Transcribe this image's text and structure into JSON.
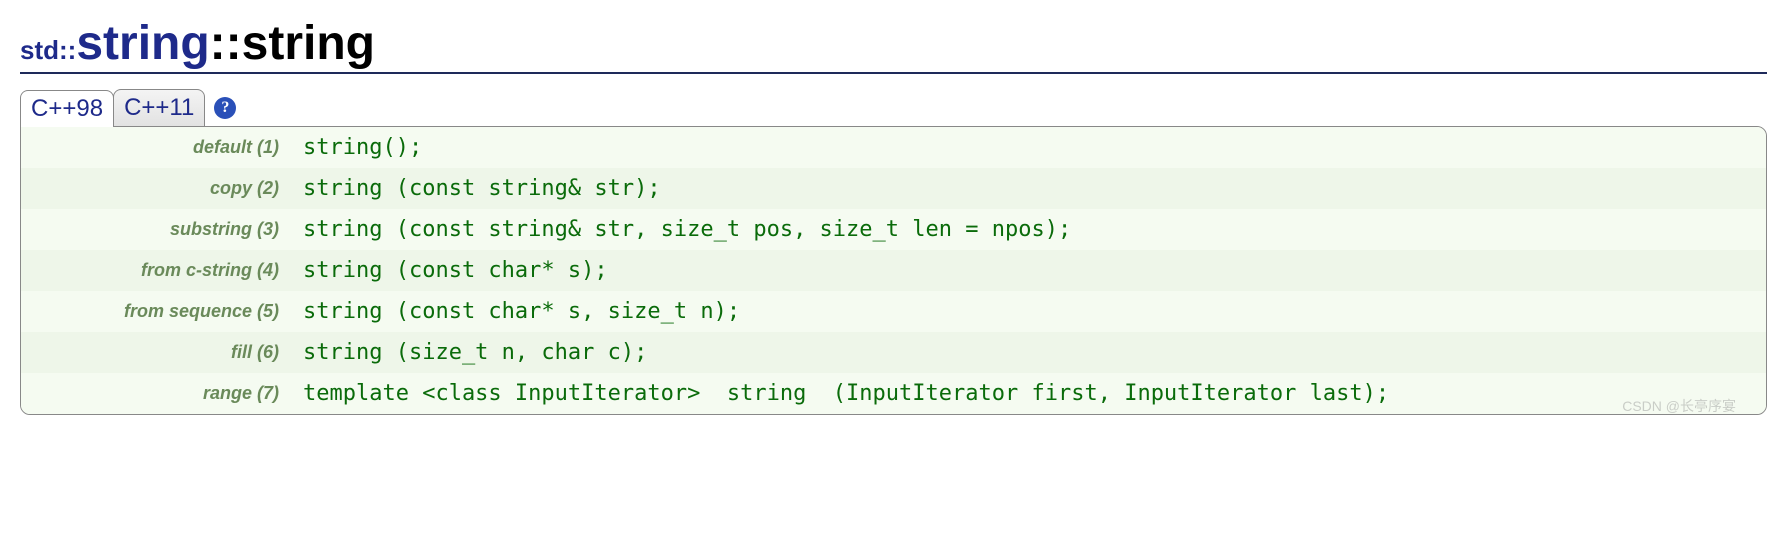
{
  "title": {
    "ns": "std::",
    "class": "string",
    "sep": "::",
    "member": "string"
  },
  "tabs": {
    "items": [
      {
        "label": "C++98",
        "active": true
      },
      {
        "label": "C++11",
        "active": false
      }
    ],
    "help": "?"
  },
  "signatures": [
    {
      "label": "default (1)",
      "code": "string();"
    },
    {
      "label": "copy (2)",
      "code": "string (const string& str);"
    },
    {
      "label": "substring (3)",
      "code": "string (const string& str, size_t pos, size_t len = npos);"
    },
    {
      "label": "from c-string (4)",
      "code": "string (const char* s);"
    },
    {
      "label": "from sequence (5)",
      "code": "string (const char* s, size_t n);"
    },
    {
      "label": "fill (6)",
      "code": "string (size_t n, char c);"
    },
    {
      "label": "range (7)",
      "code": "template <class InputIterator>  string  (InputIterator first, InputIterator last);"
    }
  ],
  "watermark": "CSDN @长亭序宴"
}
